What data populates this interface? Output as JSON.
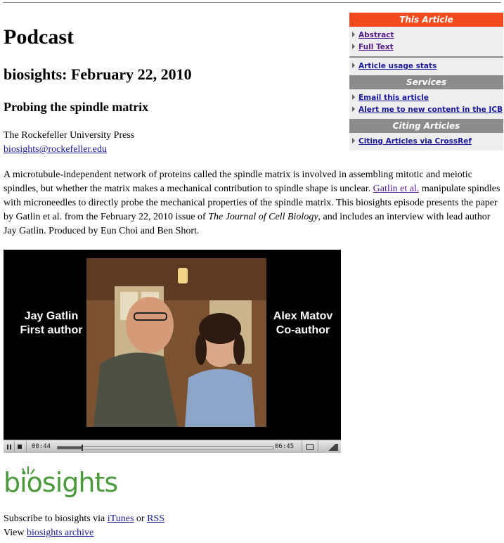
{
  "page": {
    "heading": "Podcast",
    "date_heading": "biosights: February 22, 2010",
    "article_title": "Probing the spindle matrix",
    "publisher": "The Rockefeller University Press",
    "email": "biosights@rockefeller.edu"
  },
  "abstract": {
    "part1": "A microtubule-independent network of proteins called the spindle matrix is involved in assembling mitotic and meiotic spindles, but whether the matrix makes a mechanical contribution to spindle shape is unclear. ",
    "link": "Gatlin et al.",
    "part2": " manipulate spindles with microneedles to directly probe the mechanical properties of the spindle matrix. This biosights episode presents the paper by Gatlin et al. from the February 22, 2010 issue of ",
    "journal": "The Journal of Cell Biology",
    "part3": ", and includes an interview with lead author Jay Gatlin. Produced by Eun Choi and Ben Short."
  },
  "sidebar": {
    "this_article": {
      "title": "This Article",
      "items": [
        "Abstract",
        "Full Text"
      ],
      "stats": "Article usage stats"
    },
    "services": {
      "title": "Services",
      "items": [
        "Email this article",
        "Alert me to new content in the JCB"
      ]
    },
    "citing": {
      "title": "Citing Articles",
      "items": [
        "Citing Articles via CrossRef"
      ]
    }
  },
  "player": {
    "left_label": {
      "line1": "Jay Gatlin",
      "line2": "First author"
    },
    "right_label": {
      "line1": "Alex Matov",
      "line2": "Co-author"
    },
    "time_current": "00:44",
    "time_total": "06:45",
    "progress": 0.11
  },
  "logo": {
    "text": "biosights"
  },
  "footer": {
    "subscribe_prefix": "Subscribe to biosights via ",
    "itunes": "iTunes",
    "or": " or ",
    "rss": "RSS",
    "view_prefix": "View ",
    "archive": "biosights archive"
  },
  "colors": {
    "sidebar_red": "#f04a1e",
    "sidebar_grey": "#8c8c8c",
    "logo_green": "#4a9a3c",
    "link_blue": "#1a1a9c",
    "link_visited": "#551a8b"
  }
}
